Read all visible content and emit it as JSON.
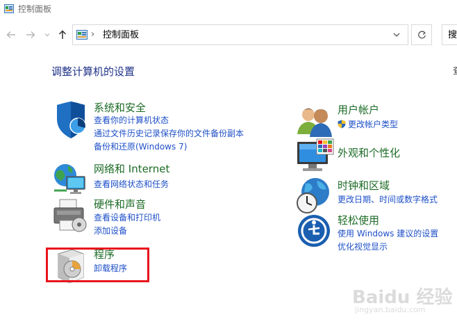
{
  "window": {
    "title": "控制面板"
  },
  "address": {
    "location": "控制面板",
    "separator": "›"
  },
  "search": {
    "placeholder_text": "搜"
  },
  "heading": "调整计算机的设置",
  "viewby_cut": "查",
  "categories": {
    "system": {
      "title": "系统和安全",
      "links": [
        "查看你的计算机状态",
        "通过文件历史记录保存你的文件备份副本",
        "备份和还原(Windows 7)"
      ]
    },
    "network": {
      "title": "网络和 Internet",
      "links": [
        "查看网络状态和任务"
      ]
    },
    "hardware": {
      "title": "硬件和声音",
      "links": [
        "查看设备和打印机",
        "添加设备"
      ]
    },
    "programs": {
      "title": "程序",
      "links": [
        "卸载程序"
      ]
    },
    "users": {
      "title": "用户帐户",
      "links": [
        "更改帐户类型"
      ]
    },
    "appearance": {
      "title": "外观和个性化",
      "links": []
    },
    "clock": {
      "title": "时钟和区域",
      "links": [
        "更改日期、时间或数字格式"
      ]
    },
    "ease": {
      "title": "轻松使用",
      "links": [
        "使用 Windows 建议的设置",
        "优化视觉显示"
      ]
    }
  },
  "watermark": {
    "main": "Baidu 经验",
    "sub": "jingyan.baidu.com"
  },
  "colors": {
    "heading": "#1e3287",
    "category_title": "#1c6b26",
    "link": "#1e50c8",
    "highlight": "#e8141c"
  }
}
